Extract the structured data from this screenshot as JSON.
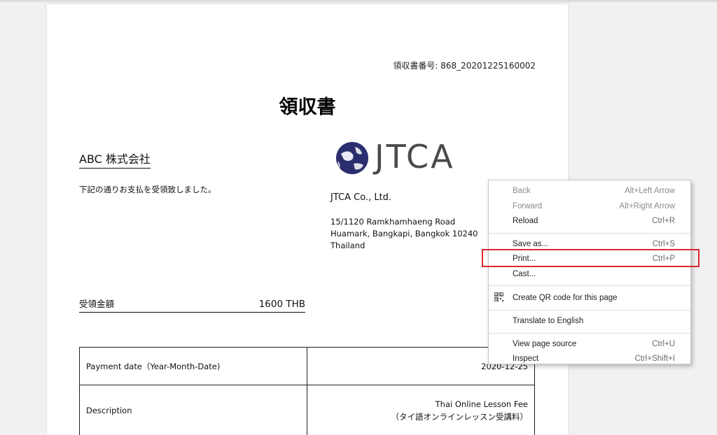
{
  "document": {
    "receipt_number": "領収書番号: 868_20201225160002",
    "title": "領収書",
    "customer_name": "ABC 株式会社",
    "acknowledgement": "下記の通りお支払を受領致しました。",
    "logo_text": "JTCA",
    "company_name": "JTCA Co., Ltd.",
    "address_lines": [
      "15/1120 Ramkhamhaeng Road",
      "Huamark, Bangkapi, Bangkok 10240",
      "Thailand"
    ],
    "amount_label": "受領金額",
    "amount_value": "1600 THB",
    "details": [
      {
        "label": "Payment date（Year-Month-Date)",
        "value": "2020-12-25"
      },
      {
        "label": "Description",
        "value_lines": [
          "Thai Online Lesson Fee",
          "（タイ語オンラインレッスン受講料）"
        ]
      }
    ]
  },
  "context_menu": {
    "items": [
      {
        "label": "Back",
        "shortcut": "Alt+Left Arrow",
        "disabled": true
      },
      {
        "label": "Forward",
        "shortcut": "Alt+Right Arrow",
        "disabled": true
      },
      {
        "label": "Reload",
        "shortcut": "Ctrl+R",
        "disabled": false
      },
      {
        "label": "Save as...",
        "shortcut": "Ctrl+S",
        "disabled": false
      },
      {
        "label": "Print...",
        "shortcut": "Ctrl+P",
        "disabled": false
      },
      {
        "label": "Cast...",
        "shortcut": "",
        "disabled": false
      },
      {
        "label": "Create QR code for this page",
        "shortcut": "",
        "icon": "qr-code-icon"
      },
      {
        "label": "Translate to English",
        "shortcut": ""
      },
      {
        "label": "View page source",
        "shortcut": "Ctrl+U"
      },
      {
        "label": "Inspect",
        "shortcut": "Ctrl+Shift+I"
      }
    ],
    "highlighted_item": "Print...",
    "highlight_color": "#e0282e"
  },
  "colors": {
    "logo_globe": "#2b2e6e",
    "background": "#f1f1f1"
  }
}
